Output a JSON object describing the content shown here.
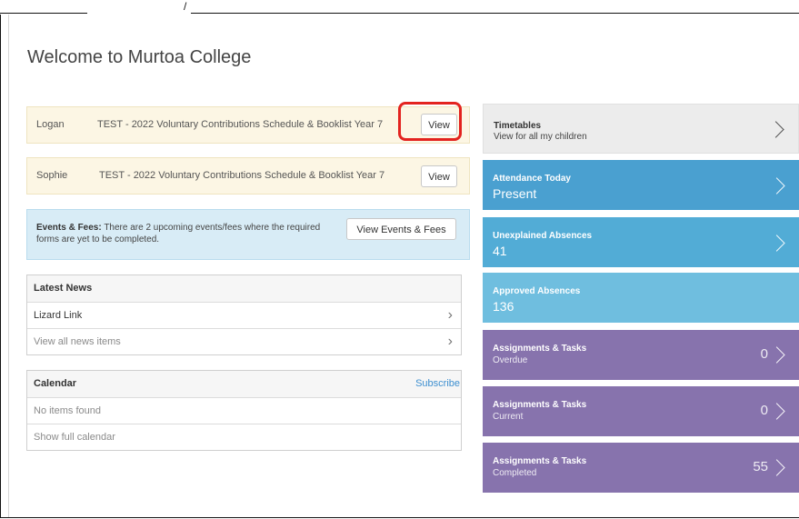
{
  "page": {
    "title": "Welcome to Murtoa College"
  },
  "notices": [
    {
      "student": "Logan",
      "document": "TEST - 2022 Voluntary Contributions Schedule & Booklist Year 7",
      "button": "View"
    },
    {
      "student": "Sophie",
      "document": "TEST - 2022 Voluntary Contributions Schedule & Booklist Year 7",
      "button": "View"
    }
  ],
  "events": {
    "label": "Events & Fees:",
    "message": "There are 2 upcoming events/fees where the required forms are yet to be completed.",
    "button": "View Events & Fees"
  },
  "news": {
    "header": "Latest News",
    "items": [
      "Lizard Link"
    ],
    "view_all": "View all news items"
  },
  "calendar": {
    "header": "Calendar",
    "subscribe": "Subscribe",
    "empty": "No items found",
    "show_full": "Show full calendar"
  },
  "tiles": {
    "timetables": {
      "title": "Timetables",
      "subtitle": "View for all my children"
    },
    "attendance": {
      "title": "Attendance Today",
      "value": "Present"
    },
    "unexplained": {
      "title": "Unexplained Absences",
      "value": "41"
    },
    "approved": {
      "title": "Approved Absences",
      "value": "136"
    },
    "overdue": {
      "title": "Assignments & Tasks",
      "subtitle": "Overdue",
      "count": "0"
    },
    "current": {
      "title": "Assignments & Tasks",
      "subtitle": "Current",
      "count": "0"
    },
    "completed": {
      "title": "Assignments & Tasks",
      "subtitle": "Completed",
      "count": "55"
    }
  },
  "colors": {
    "notice_bg": "#fcf6e4",
    "events_bg": "#d8ecf6",
    "attendance_blue": "#4aa0d0",
    "assignments_purple": "#8773ad",
    "highlight_red": "#e3231f",
    "link_blue": "#3d8fd0"
  }
}
